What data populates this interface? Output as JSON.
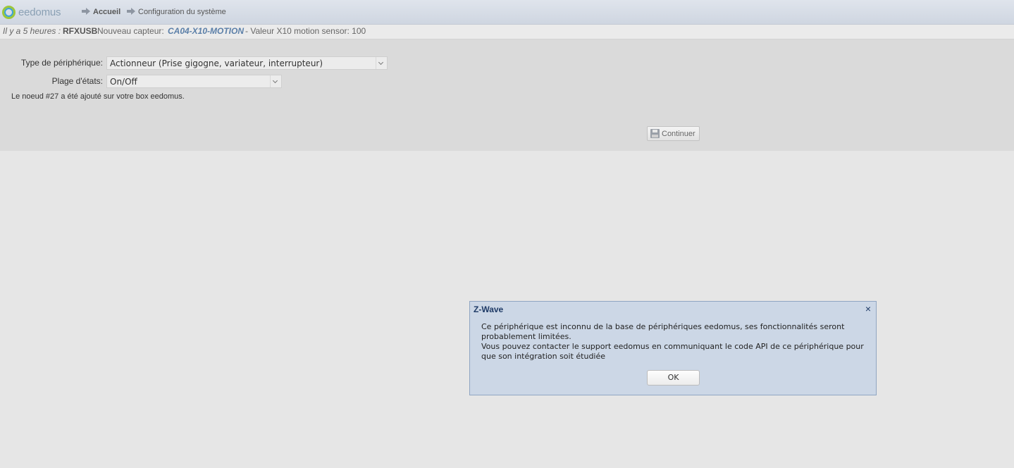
{
  "header": {
    "logo_text": "eedomus",
    "breadcrumb": {
      "home": "Accueil",
      "current": "Configuration du système"
    }
  },
  "notification": {
    "time": "Il y a 5 heures :",
    "source": "RFXUSB",
    "label": "Nouveau capteur:",
    "device": "CA04-X10-MOTION",
    "value": "- Valeur X10 motion sensor: 100"
  },
  "form": {
    "type_label": "Type de périphérique:",
    "type_value": "Actionneur (Prise gigogne, variateur, interrupteur)",
    "range_label": "Plage d'états:",
    "range_value": "On/Off",
    "node_message": "Le noeud #27 a été ajouté sur votre box eedomus.",
    "continue_label": "Continuer"
  },
  "dialog": {
    "title": "Z-Wave",
    "close": "×",
    "line1": "Ce périphérique est inconnu de la base de périphériques eedomus, ses fonctionnalités seront probablement limitées.",
    "line2": "Vous pouvez contacter le support eedomus en communiquant le code API de ce périphérique pour que son intégration soit étudiée",
    "ok_label": "OK"
  }
}
